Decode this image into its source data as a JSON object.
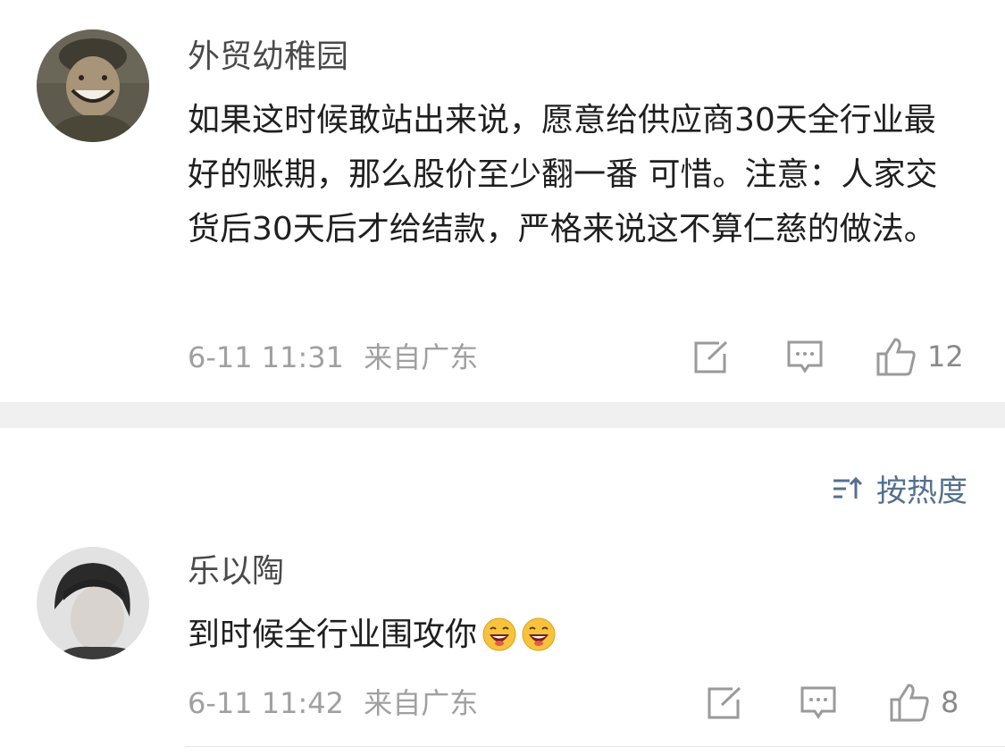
{
  "comments": [
    {
      "username": "外贸幼稚园",
      "text": "如果这时候敢站出来说，愿意给供应商30天全行业最好的账期，那么股价至少翻一番 可惜。注意：人家交货后30天后才给结款，严格来说这不算仁慈的做法。",
      "date": "6-11 11:31",
      "location": "来自广东",
      "likes": "12"
    },
    {
      "username": "乐以陶",
      "text": "到时候全行业围攻你",
      "emojis": [
        "laughing-emoji",
        "laughing-emoji"
      ],
      "date": "6-11 11:42",
      "location": "来自广东",
      "likes": "8"
    }
  ],
  "sort": {
    "label": "按热度"
  },
  "colors": {
    "username": "#4a4a4a",
    "text": "#1f1f1f",
    "meta": "#a0a0a0",
    "sort": "#54708f",
    "band": "#f0f0f0"
  }
}
